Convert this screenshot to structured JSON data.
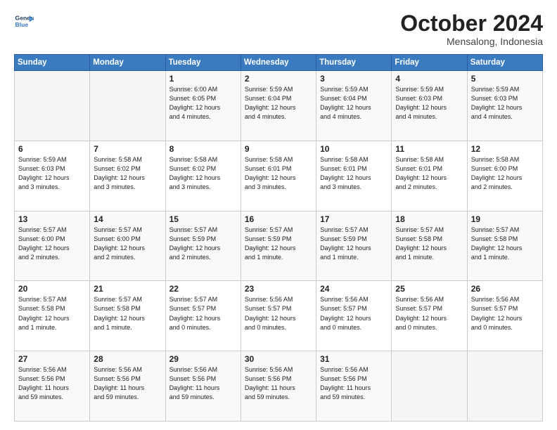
{
  "logo": {
    "line1": "General",
    "line2": "Blue"
  },
  "header": {
    "month": "October 2024",
    "location": "Mensalong, Indonesia"
  },
  "days_of_week": [
    "Sunday",
    "Monday",
    "Tuesday",
    "Wednesday",
    "Thursday",
    "Friday",
    "Saturday"
  ],
  "weeks": [
    [
      {
        "day": "",
        "info": ""
      },
      {
        "day": "",
        "info": ""
      },
      {
        "day": "1",
        "info": "Sunrise: 6:00 AM\nSunset: 6:05 PM\nDaylight: 12 hours\nand 4 minutes."
      },
      {
        "day": "2",
        "info": "Sunrise: 5:59 AM\nSunset: 6:04 PM\nDaylight: 12 hours\nand 4 minutes."
      },
      {
        "day": "3",
        "info": "Sunrise: 5:59 AM\nSunset: 6:04 PM\nDaylight: 12 hours\nand 4 minutes."
      },
      {
        "day": "4",
        "info": "Sunrise: 5:59 AM\nSunset: 6:03 PM\nDaylight: 12 hours\nand 4 minutes."
      },
      {
        "day": "5",
        "info": "Sunrise: 5:59 AM\nSunset: 6:03 PM\nDaylight: 12 hours\nand 4 minutes."
      }
    ],
    [
      {
        "day": "6",
        "info": "Sunrise: 5:59 AM\nSunset: 6:03 PM\nDaylight: 12 hours\nand 3 minutes."
      },
      {
        "day": "7",
        "info": "Sunrise: 5:58 AM\nSunset: 6:02 PM\nDaylight: 12 hours\nand 3 minutes."
      },
      {
        "day": "8",
        "info": "Sunrise: 5:58 AM\nSunset: 6:02 PM\nDaylight: 12 hours\nand 3 minutes."
      },
      {
        "day": "9",
        "info": "Sunrise: 5:58 AM\nSunset: 6:01 PM\nDaylight: 12 hours\nand 3 minutes."
      },
      {
        "day": "10",
        "info": "Sunrise: 5:58 AM\nSunset: 6:01 PM\nDaylight: 12 hours\nand 3 minutes."
      },
      {
        "day": "11",
        "info": "Sunrise: 5:58 AM\nSunset: 6:01 PM\nDaylight: 12 hours\nand 2 minutes."
      },
      {
        "day": "12",
        "info": "Sunrise: 5:58 AM\nSunset: 6:00 PM\nDaylight: 12 hours\nand 2 minutes."
      }
    ],
    [
      {
        "day": "13",
        "info": "Sunrise: 5:57 AM\nSunset: 6:00 PM\nDaylight: 12 hours\nand 2 minutes."
      },
      {
        "day": "14",
        "info": "Sunrise: 5:57 AM\nSunset: 6:00 PM\nDaylight: 12 hours\nand 2 minutes."
      },
      {
        "day": "15",
        "info": "Sunrise: 5:57 AM\nSunset: 5:59 PM\nDaylight: 12 hours\nand 2 minutes."
      },
      {
        "day": "16",
        "info": "Sunrise: 5:57 AM\nSunset: 5:59 PM\nDaylight: 12 hours\nand 1 minute."
      },
      {
        "day": "17",
        "info": "Sunrise: 5:57 AM\nSunset: 5:59 PM\nDaylight: 12 hours\nand 1 minute."
      },
      {
        "day": "18",
        "info": "Sunrise: 5:57 AM\nSunset: 5:58 PM\nDaylight: 12 hours\nand 1 minute."
      },
      {
        "day": "19",
        "info": "Sunrise: 5:57 AM\nSunset: 5:58 PM\nDaylight: 12 hours\nand 1 minute."
      }
    ],
    [
      {
        "day": "20",
        "info": "Sunrise: 5:57 AM\nSunset: 5:58 PM\nDaylight: 12 hours\nand 1 minute."
      },
      {
        "day": "21",
        "info": "Sunrise: 5:57 AM\nSunset: 5:58 PM\nDaylight: 12 hours\nand 1 minute."
      },
      {
        "day": "22",
        "info": "Sunrise: 5:57 AM\nSunset: 5:57 PM\nDaylight: 12 hours\nand 0 minutes."
      },
      {
        "day": "23",
        "info": "Sunrise: 5:56 AM\nSunset: 5:57 PM\nDaylight: 12 hours\nand 0 minutes."
      },
      {
        "day": "24",
        "info": "Sunrise: 5:56 AM\nSunset: 5:57 PM\nDaylight: 12 hours\nand 0 minutes."
      },
      {
        "day": "25",
        "info": "Sunrise: 5:56 AM\nSunset: 5:57 PM\nDaylight: 12 hours\nand 0 minutes."
      },
      {
        "day": "26",
        "info": "Sunrise: 5:56 AM\nSunset: 5:57 PM\nDaylight: 12 hours\nand 0 minutes."
      }
    ],
    [
      {
        "day": "27",
        "info": "Sunrise: 5:56 AM\nSunset: 5:56 PM\nDaylight: 11 hours\nand 59 minutes."
      },
      {
        "day": "28",
        "info": "Sunrise: 5:56 AM\nSunset: 5:56 PM\nDaylight: 11 hours\nand 59 minutes."
      },
      {
        "day": "29",
        "info": "Sunrise: 5:56 AM\nSunset: 5:56 PM\nDaylight: 11 hours\nand 59 minutes."
      },
      {
        "day": "30",
        "info": "Sunrise: 5:56 AM\nSunset: 5:56 PM\nDaylight: 11 hours\nand 59 minutes."
      },
      {
        "day": "31",
        "info": "Sunrise: 5:56 AM\nSunset: 5:56 PM\nDaylight: 11 hours\nand 59 minutes."
      },
      {
        "day": "",
        "info": ""
      },
      {
        "day": "",
        "info": ""
      }
    ]
  ]
}
